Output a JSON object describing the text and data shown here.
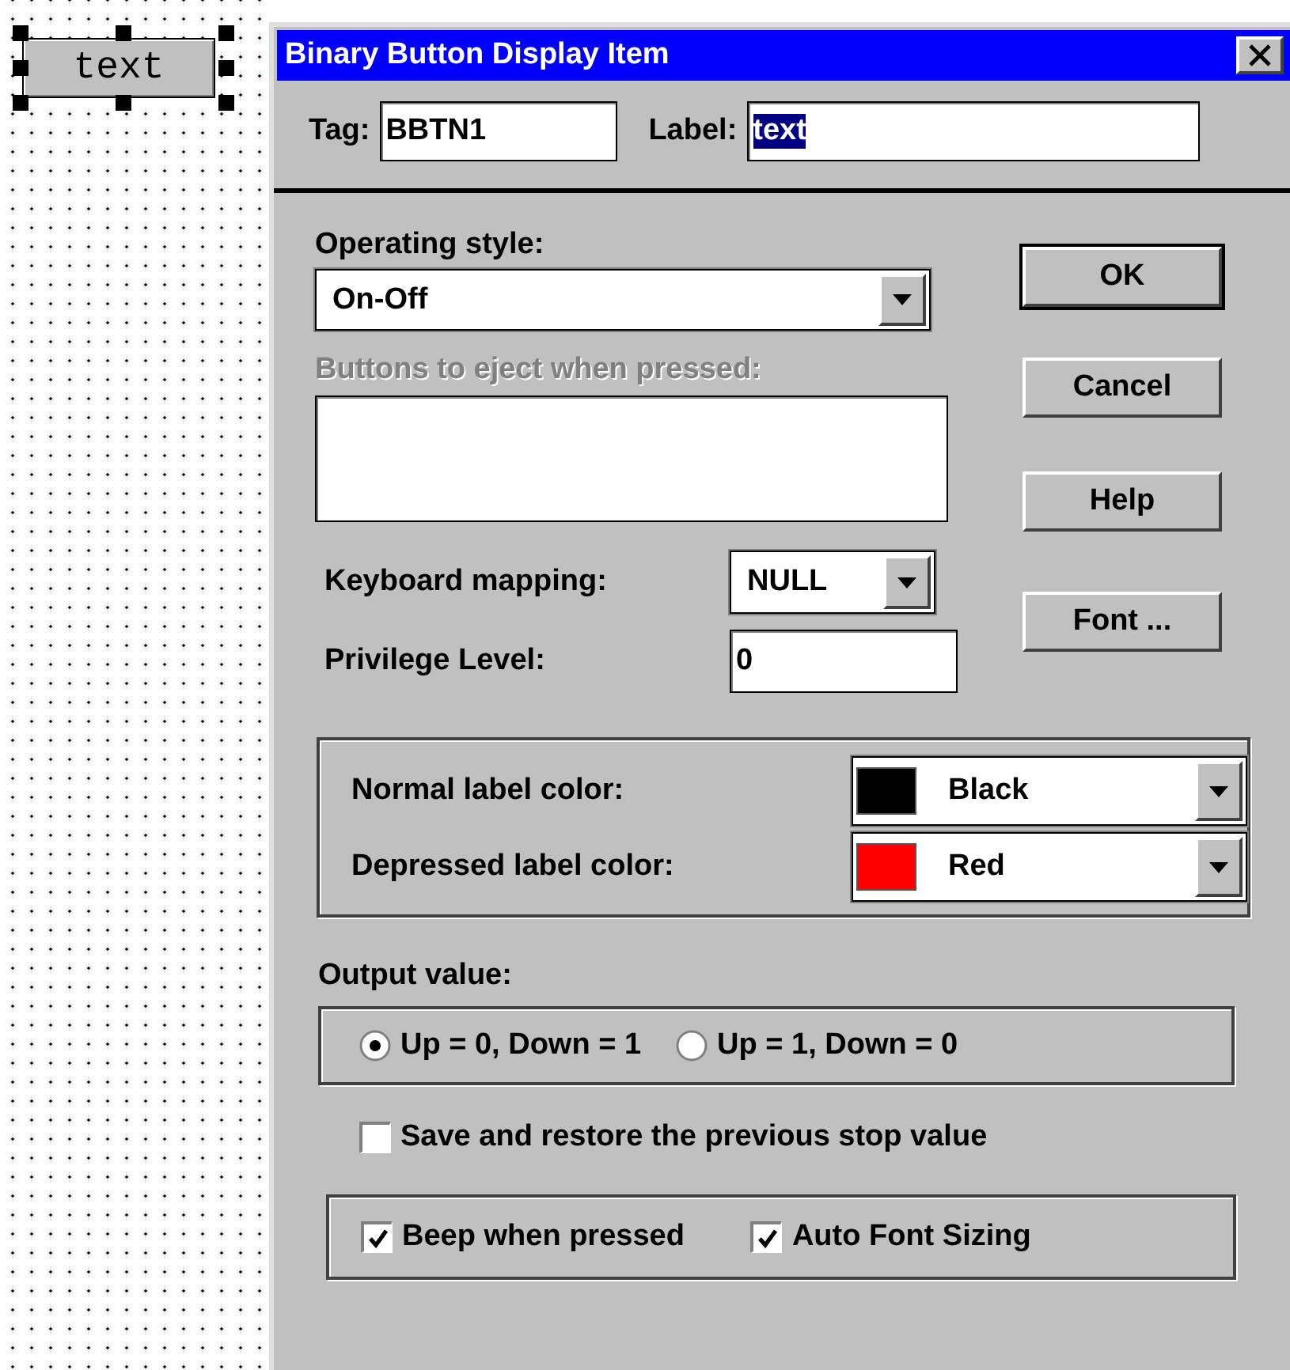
{
  "canvas": {
    "widget": {
      "label": "text",
      "selected": true
    }
  },
  "window": {
    "title": "Binary Button Display Item"
  },
  "tag": {
    "label": "Tag:",
    "value": "BBTN1"
  },
  "label_field": {
    "label": "Label:",
    "value": "text",
    "selected": true
  },
  "operating_style": {
    "label": "Operating style:",
    "value": "On-Off"
  },
  "eject": {
    "label": "Buttons to eject when pressed:",
    "disabled": true
  },
  "keyboard_mapping": {
    "label": "Keyboard mapping:",
    "value": "NULL"
  },
  "privilege_level": {
    "label": "Privilege Level:",
    "value": "0"
  },
  "buttons": [
    {
      "label": "OK",
      "default": true
    },
    {
      "label": "Cancel",
      "default": false
    },
    {
      "label": "Help",
      "default": false
    },
    {
      "label": "Font ...",
      "default": false
    }
  ],
  "label_colors": [
    {
      "label": "Normal label color:",
      "value": "Black",
      "color": "#000000"
    },
    {
      "label": "Depressed label color:",
      "value": "Red",
      "color": "#ff0000"
    }
  ],
  "output_value": {
    "label": "Output value:",
    "options": [
      {
        "label": "Up = 0, Down = 1",
        "selected": true
      },
      {
        "label": "Up = 1, Down = 0",
        "selected": false
      }
    ]
  },
  "save_restore": {
    "label": "Save and restore the previous stop value",
    "checked": false
  },
  "options": [
    {
      "label": "Beep when pressed",
      "checked": true
    },
    {
      "label": "Auto Font Sizing",
      "checked": true
    }
  ]
}
